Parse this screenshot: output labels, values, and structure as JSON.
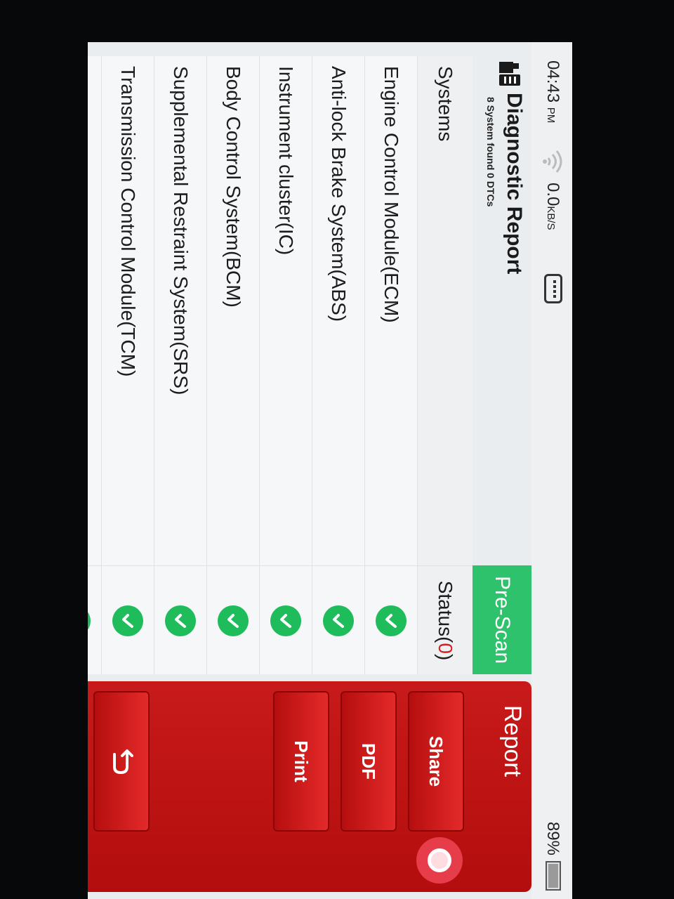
{
  "status_bar": {
    "time": "04:43",
    "time_suffix": "PM",
    "net_speed": "0.0",
    "net_unit": "KB/S",
    "battery": "89%"
  },
  "header": {
    "title": "Diagnostic Report",
    "subtitle": "8 System found 0 DTCs",
    "scan_tab": "Pre-Scan"
  },
  "table": {
    "col_systems": "Systems",
    "col_status": "Status(",
    "status_count": "0",
    "status_close": ")",
    "rows": [
      "Engine Control Module(ECM)",
      "Anti-lock Brake System(ABS)",
      "Instrument cluster(IC)",
      "Body Control System(BCM)",
      "Supplemental Restraint System(SRS)",
      "Transmission Control Module(TCM)"
    ]
  },
  "panel": {
    "title": "Report",
    "share": "Share",
    "pdf": "PDF",
    "print": "Print"
  },
  "colors": {
    "ok_green": "#1fbc5b",
    "prescan_green": "#2ec26d",
    "panel_red": "#c81a1a",
    "dtc_count_red": "#d81e1e"
  },
  "icons": {
    "status_ok": "check-circle-icon",
    "back": "return-arrow-icon",
    "wifi": "wifi-icon",
    "keyboard": "keyboard-icon",
    "report": "report-doc-icon"
  }
}
